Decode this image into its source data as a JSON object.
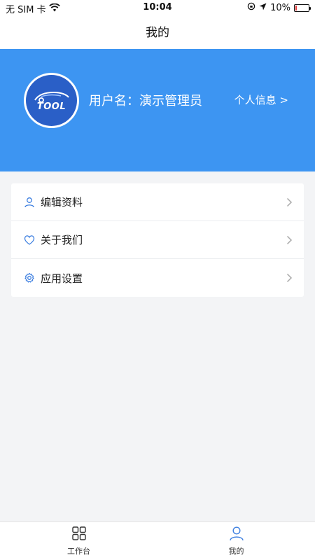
{
  "status": {
    "carrier": "无 SIM 卡",
    "time": "10:04",
    "battery": "10%",
    "battery_level": 0.1,
    "low_battery_color": "#e23b3b"
  },
  "nav": {
    "title": "我的"
  },
  "profile": {
    "logo_text": "TOOL",
    "username": "用户名：演示管理员",
    "info_link": "个人信息 >"
  },
  "menu": {
    "items": [
      {
        "label": "编辑资料",
        "icon": "user-icon"
      },
      {
        "label": "关于我们",
        "icon": "heart-icon"
      },
      {
        "label": "应用设置",
        "icon": "gear-icon"
      }
    ]
  },
  "tabs": {
    "items": [
      {
        "label": "工作台",
        "icon": "grid-icon",
        "active": false
      },
      {
        "label": "我的",
        "icon": "user-icon",
        "active": true
      }
    ]
  },
  "colors": {
    "brand": "#3d95f2",
    "icon_blue": "#3d7fe0"
  }
}
